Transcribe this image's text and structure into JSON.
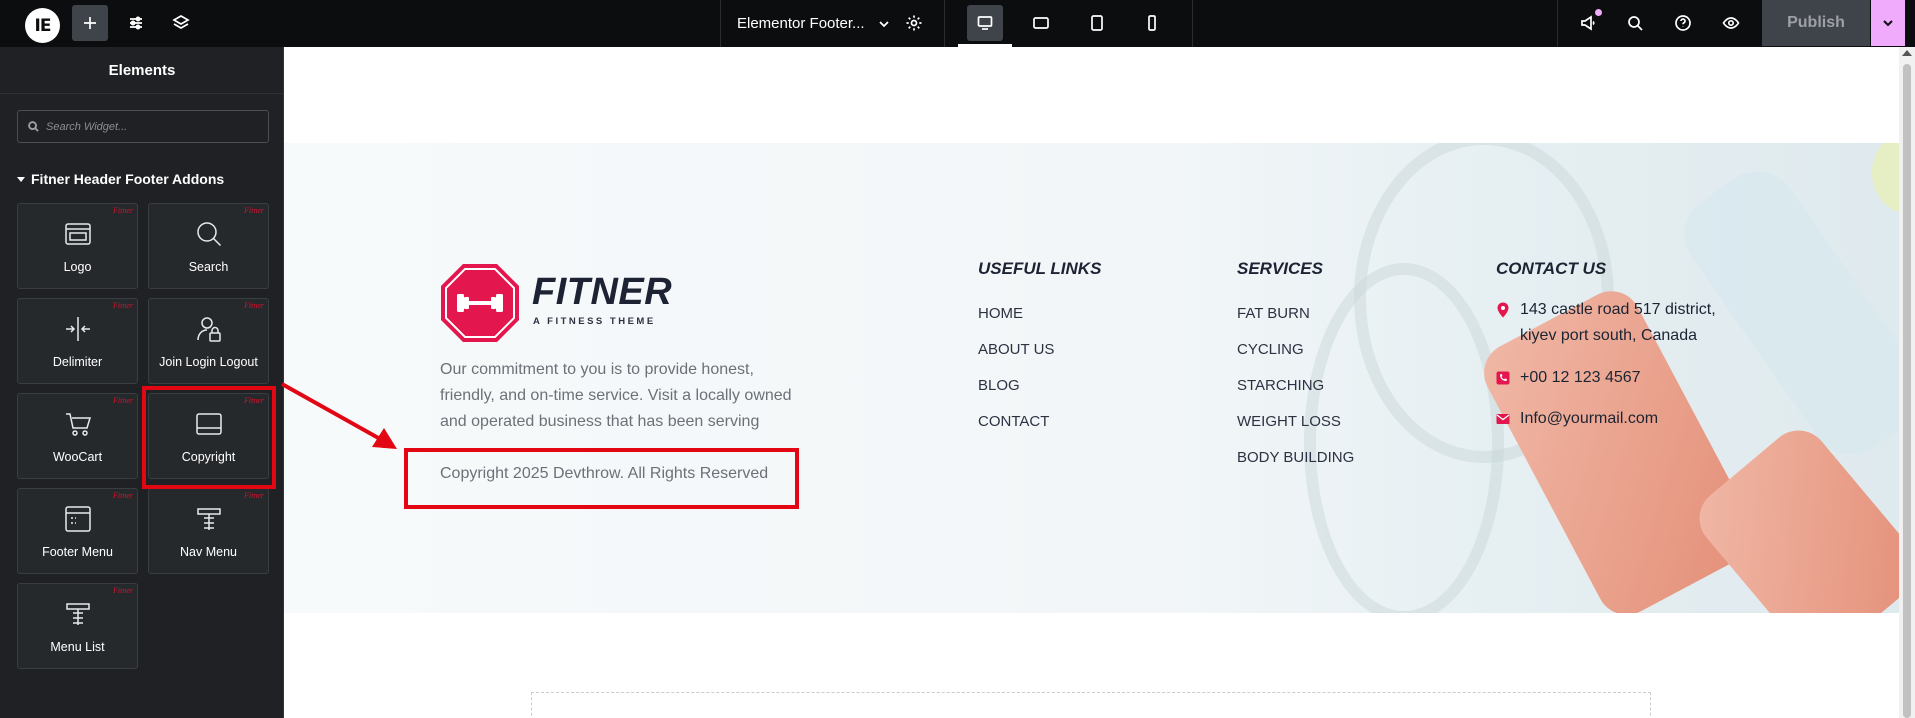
{
  "topbar": {
    "document_title": "Elementor Footer...",
    "publish_label": "Publish",
    "icons": [
      "elementor-logo-icon",
      "plus-icon",
      "sliders-icon",
      "layers-icon",
      "settings-icon",
      "desktop-icon",
      "tablet-landscape-icon",
      "tablet-portrait-icon",
      "mobile-icon",
      "megaphone-icon",
      "search-icon",
      "help-icon",
      "eye-icon",
      "chevron-down-icon"
    ]
  },
  "sidebar": {
    "title": "Elements",
    "search_placeholder": "Search Widget...",
    "category": "Fitner Header Footer Addons",
    "widgets": [
      {
        "label": "Logo",
        "badge": "Fitner",
        "icon": "logo-icon"
      },
      {
        "label": "Search",
        "badge": "Fitner",
        "icon": "search-icon"
      },
      {
        "label": "Delimiter",
        "badge": "Fitner",
        "icon": "delimiter-icon"
      },
      {
        "label": "Join Login Logout",
        "badge": "Fitner",
        "icon": "user-lock-icon"
      },
      {
        "label": "WooCart",
        "badge": "Fitner",
        "icon": "cart-icon"
      },
      {
        "label": "Copyright",
        "badge": "Fitner",
        "icon": "copyright-icon"
      },
      {
        "label": "Footer Menu",
        "badge": "Fitner",
        "icon": "footer-menu-icon"
      },
      {
        "label": "Nav Menu",
        "badge": "Fitner",
        "icon": "nav-menu-icon"
      },
      {
        "label": "Menu List",
        "badge": "Fitner",
        "icon": "menu-list-icon"
      }
    ]
  },
  "footer": {
    "brand_name": "FITNER",
    "brand_tagline": "A FITNESS THEME",
    "about": "Our commitment to you is to provide honest, friendly, and on-time service. Visit a locally owned and operated business that has been serving",
    "copyright": "Copyright 2025 Devthrow. All Rights Reserved",
    "useful_links": {
      "title": "USEFUL LINKS",
      "items": [
        "HOME",
        "ABOUT US",
        "BLOG",
        "CONTACT"
      ]
    },
    "services": {
      "title": "SERVICES",
      "items": [
        "FAT BURN",
        "CYCLING",
        "STARCHING",
        "WEIGHT LOSS",
        "BODY BUILDING"
      ]
    },
    "contact": {
      "title": "CONTACT US",
      "address_line1": "143 castle road 517 district,",
      "address_line2": "kiyev port south, Canada",
      "phone": "+00 12 123 4567",
      "email": "Info@yourmail.com"
    }
  },
  "colors": {
    "brand_red": "#e3174d",
    "annotation_red": "#e30613",
    "editor_dark": "#0c0d0e",
    "accent_pink": "#f0abfc"
  }
}
